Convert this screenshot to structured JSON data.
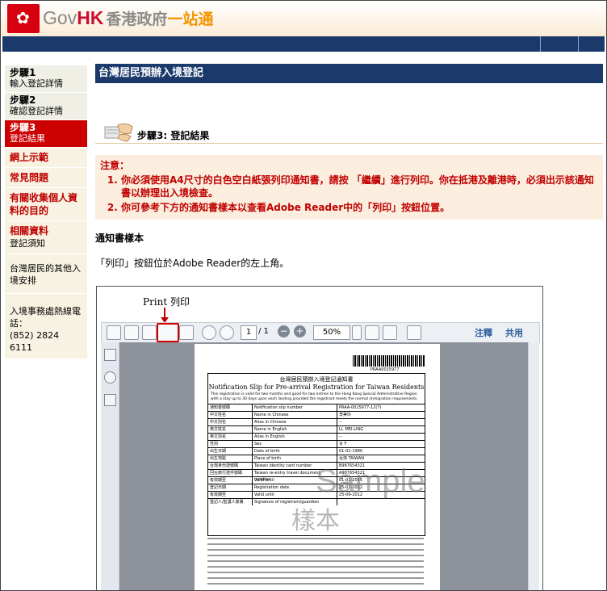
{
  "header": {
    "logo_gov": "Gov",
    "logo_hk": "HK",
    "logo_zh1": "香港政府",
    "logo_zh2": "一站通"
  },
  "sidebar": {
    "steps": [
      {
        "title": "步驟1",
        "sub": "輸入登記詳情"
      },
      {
        "title": "步驟2",
        "sub": "確認登記詳情"
      },
      {
        "title": "步驟3",
        "sub": "登記結果"
      }
    ],
    "links": [
      {
        "label": "網上示範",
        "sub": ""
      },
      {
        "label": "常見問題",
        "sub": ""
      },
      {
        "label": "有關收集個人資料的目的",
        "sub": ""
      },
      {
        "label": "相關資料",
        "sub": "登記須知"
      }
    ],
    "other": "台灣居民的其他入境安排",
    "hotline_label": "入境事務處熱線電話：",
    "hotline": "(852) 2824 6111"
  },
  "main": {
    "title": "台灣居民預辦入境登記",
    "step_title": "步驟3: 登記結果",
    "notice_title": "注意：",
    "notice_items": [
      "你必須使用A4尺寸的白色空白紙張列印通知書，請按 「繼續」進行列印。你在抵港及離港時，必須出示該通知書以辦理出入境檢查。",
      "你可參考下方的通知書樣本以查看Adobe Reader中的「列印」按鈕位置。"
    ],
    "sample_heading": "通知書樣本",
    "sample_text": "「列印」按鈕位於Adobe Reader的左上角。"
  },
  "sample_image": {
    "print_caption": "Print  列印",
    "page_current": "1",
    "page_total": "/ 1",
    "zoom": "50%",
    "link_annotate": "注釋",
    "link_share": "共用",
    "barcode_text": "PRAA0015977",
    "form_title_zh": "台灣居民預辦入境登記通知書",
    "form_title_en": "Notification Slip for Pre-arrival Registration for Taiwan Residents",
    "form_intro": "This registration is valid for two months and good for two entries to the Hong Kong Special Administrative Region with a stay up to 30 days upon each landing provided the registrant meets the normal immigration requirements.",
    "form_rows": [
      [
        "通知書號碼",
        "Notification slip number",
        "PRAA-0015977-12(7)"
      ],
      [
        "中文姓名",
        "Name in Chinese",
        "李美玲"
      ],
      [
        "中文別名",
        "Alias in Chinese",
        "--"
      ],
      [
        "英文姓名",
        "Name in English",
        "LI, MEI-LING"
      ],
      [
        "英文別名",
        "Alias in English",
        "--"
      ],
      [
        "性別",
        "Sex",
        "女 F"
      ],
      [
        "出生日期",
        "Date of birth",
        "01-01-1980"
      ],
      [
        "出生地點",
        "Place of birth",
        "台灣 TAIWAN"
      ],
      [
        "台灣身份證號碼",
        "Taiwan identity card number",
        "B987654321"
      ],
      [
        "回台旅行證件號碼",
        "Taiwan re-entry travel document number",
        "A987654321"
      ],
      [
        "有效期至",
        "Valid until",
        "01-01-2015"
      ],
      [
        "登記日期",
        "Registration date",
        "25-07-2012"
      ],
      [
        "有效期至",
        "Valid until",
        "25-09-2012"
      ],
      [
        "登記人/監護人簽署",
        "Signature of registrant/guardian",
        ""
      ]
    ],
    "watermark_en": "Sample",
    "watermark_zh": "樣本"
  }
}
